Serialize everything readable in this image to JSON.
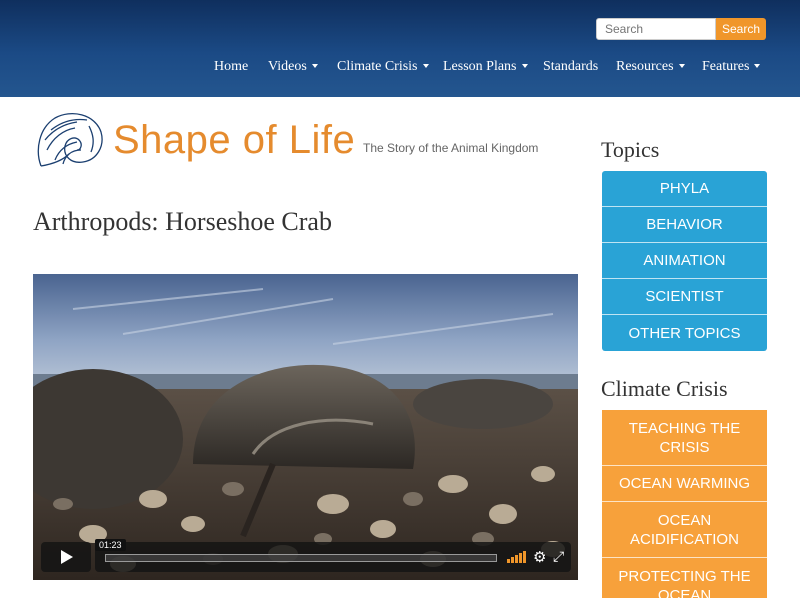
{
  "header": {
    "search_placeholder": "Search",
    "search_button": "Search",
    "nav": [
      {
        "label": "Home",
        "dropdown": false
      },
      {
        "label": "Videos",
        "dropdown": true
      },
      {
        "label": "Climate Crisis",
        "dropdown": true
      },
      {
        "label": "Lesson Plans",
        "dropdown": true
      },
      {
        "label": "Standards",
        "dropdown": false
      },
      {
        "label": "Resources",
        "dropdown": true
      },
      {
        "label": "Features",
        "dropdown": true
      }
    ]
  },
  "logo": {
    "title": "Shape of Life",
    "tagline": "The Story of the Animal Kingdom"
  },
  "page_title": "Arthropods: Horseshoe Crab",
  "video": {
    "time": "01:23",
    "progress_fraction": 0.0
  },
  "sidebar": {
    "topics_heading": "Topics",
    "topics": [
      "PHYLA",
      "BEHAVIOR",
      "ANIMATION",
      "SCIENTIST",
      "OTHER TOPICS"
    ],
    "climate_heading": "Climate Crisis",
    "climate": [
      "TEACHING THE CRISIS",
      "OCEAN WARMING",
      "OCEAN ACIDIFICATION",
      "PROTECTING THE OCEAN"
    ]
  },
  "colors": {
    "header_blue": "#1b4a85",
    "accent_orange": "#f0962a",
    "topics_blue": "#29a3d6",
    "climate_orange": "#f7a13b"
  }
}
